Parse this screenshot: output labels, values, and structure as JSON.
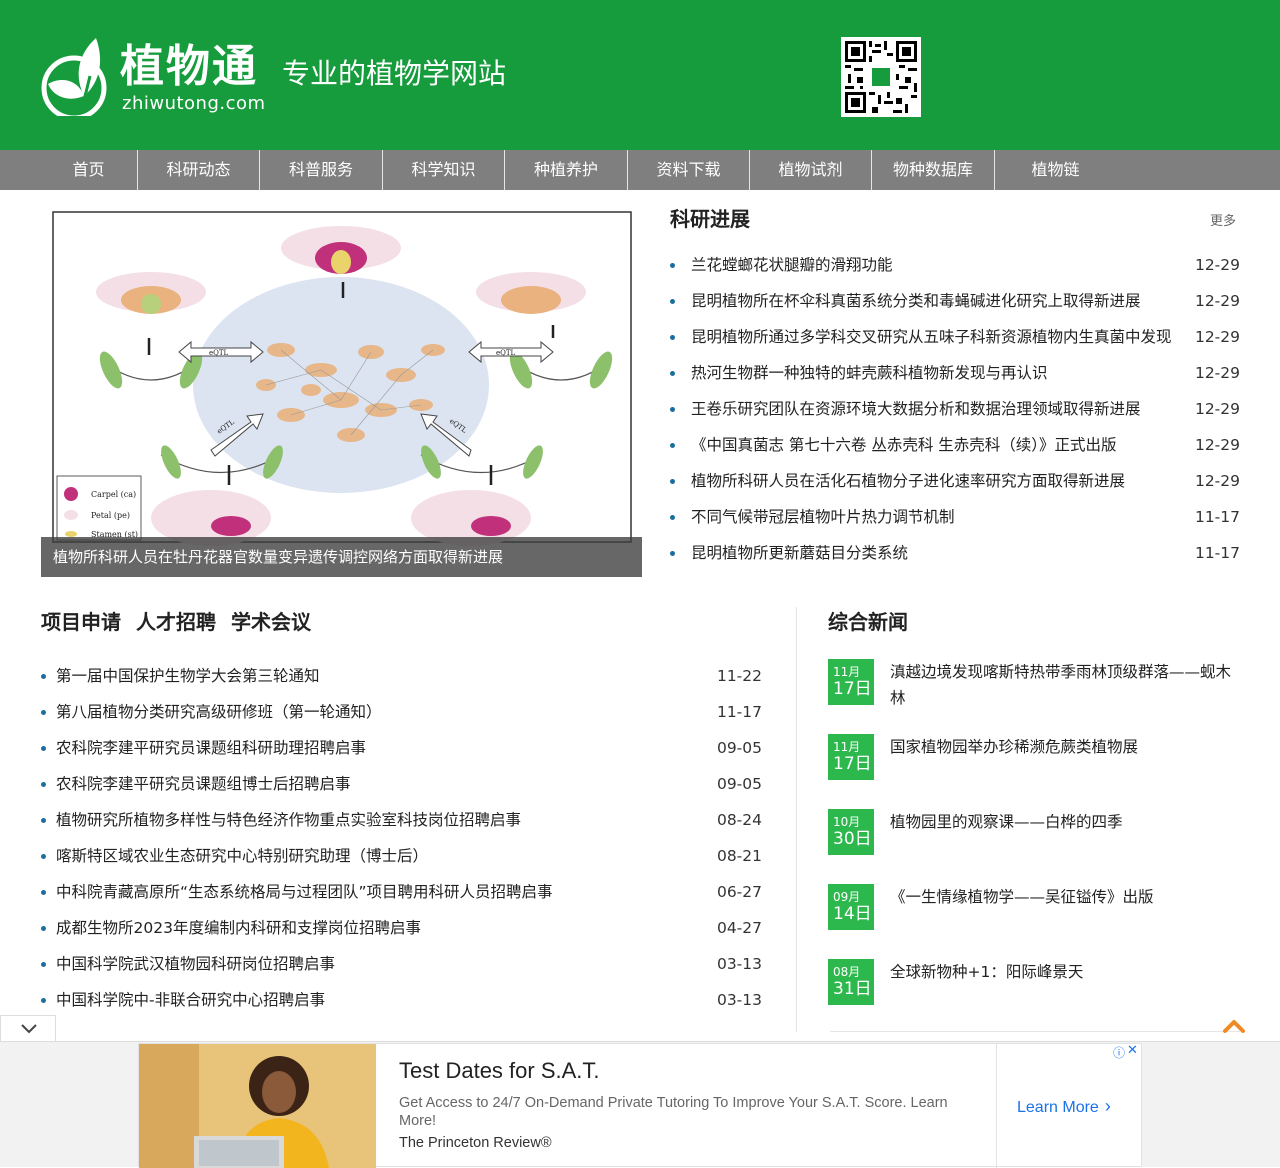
{
  "header": {
    "logo_cn": "植物通",
    "logo_en": "zhiwutong.com",
    "tagline": "专业的植物学网站"
  },
  "nav": {
    "items": [
      "首页",
      "科研动态",
      "科普服务",
      "科学知识",
      "种植养护",
      "资料下载",
      "植物试剂",
      "物种数据库",
      "植物链"
    ]
  },
  "featured": {
    "caption": "植物所科研人员在牡丹花器官数量变异遗传调控网络方面取得新进展",
    "figure_labels": {
      "legend_carpel": "Carpel (ca)",
      "legend_petal": "Petal (pe)",
      "legend_stamen": "Stamen (st)",
      "eqtl": "eQTL"
    }
  },
  "research": {
    "title": "科研进展",
    "more": "更多",
    "items": [
      {
        "title": "兰花螳螂花状腿瓣的滑翔功能",
        "date": "12-29"
      },
      {
        "title": "昆明植物所在杯伞科真菌系统分类和毒蝇碱进化研究上取得新进展",
        "date": "12-29"
      },
      {
        "title": "昆明植物所通过多学科交叉研究从五味子科新资源植物内生真菌中发现",
        "date": "12-29"
      },
      {
        "title": "热河生物群一种独特的蚌壳蕨科植物新发现与再认识",
        "date": "12-29"
      },
      {
        "title": "王卷乐研究团队在资源环境大数据分析和数据治理领域取得新进展",
        "date": "12-29"
      },
      {
        "title": "《中国真菌志 第七十六卷 丛赤壳科 生赤壳科（续）》正式出版",
        "date": "12-29"
      },
      {
        "title": "植物所科研人员在活化石植物分子进化速率研究方面取得新进展",
        "date": "12-29"
      },
      {
        "title": "不同气候带冠层植物叶片热力调节机制",
        "date": "11-17"
      },
      {
        "title": "昆明植物所更新蘑菇目分类系统",
        "date": "11-17"
      }
    ]
  },
  "projects": {
    "tabs": [
      "项目申请",
      "人才招聘",
      "学术会议"
    ],
    "items": [
      {
        "title": "第一届中国保护生物学大会第三轮通知",
        "date": "11-22"
      },
      {
        "title": "第八届植物分类研究高级研修班（第一轮通知）",
        "date": "11-17"
      },
      {
        "title": "农科院李建平研究员课题组科研助理招聘启事",
        "date": "09-05"
      },
      {
        "title": "农科院李建平研究员课题组博士后招聘启事",
        "date": "09-05"
      },
      {
        "title": "植物研究所植物多样性与特色经济作物重点实验室科技岗位招聘启事",
        "date": "08-24"
      },
      {
        "title": "喀斯特区域农业生态研究中心特别研究助理（博士后）",
        "date": "08-21"
      },
      {
        "title": "中科院青藏高原所“生态系统格局与过程团队”项目聘用科研人员招聘启事",
        "date": "06-27"
      },
      {
        "title": "成都生物所2023年度编制内科研和支撑岗位招聘启事",
        "date": "04-27"
      },
      {
        "title": "中国科学院武汉植物园科研岗位招聘启事",
        "date": "03-13"
      },
      {
        "title": "中国科学院中-非联合研究中心招聘启事",
        "date": "03-13"
      }
    ]
  },
  "general_news": {
    "title": "综合新闻",
    "items": [
      {
        "month": "11月",
        "day": "17日",
        "title": "滇越边境发现喀斯特热带季雨林顶级群落——蚬木林"
      },
      {
        "month": "11月",
        "day": "17日",
        "title": "国家植物园举办珍稀濒危蕨类植物展"
      },
      {
        "month": "10月",
        "day": "30日",
        "title": "植物园里的观察课——白桦的四季"
      },
      {
        "month": "09月",
        "day": "14日",
        "title": "《一生情缘植物学——吴征镒传》出版"
      },
      {
        "month": "08月",
        "day": "31日",
        "title": "全球新物种+1：阳际峰景天"
      }
    ]
  },
  "ad": {
    "title": "Test Dates for S.A.T.",
    "description": "Get Access to 24/7 On-Demand Private Tutoring To Improve Your S.A.T. Score. Learn More!",
    "brand": "The Princeton Review®",
    "cta": "Learn More"
  },
  "colors": {
    "brand_green": "#169c3c",
    "nav_gray": "#7f7f7f",
    "date_green": "#2db84d",
    "bullet_blue": "#1b6f9b"
  }
}
